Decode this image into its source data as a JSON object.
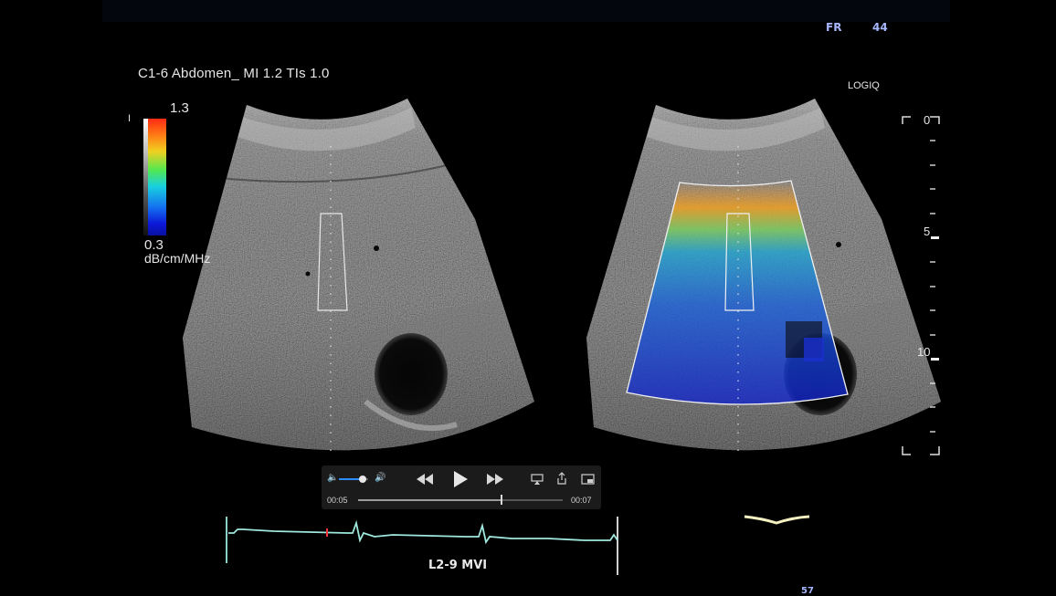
{
  "header": {
    "fr_label": "FR",
    "fr_value": "44"
  },
  "probe_info": "C1-6  Abdomen_  MI 1.2  TIs 1.0",
  "brand": "LOGIQ",
  "color_scale": {
    "max": "1.3",
    "min": "0.3",
    "unit": "dB/cm/MHz",
    "tick": "I"
  },
  "depth_scale": {
    "labels": [
      "0",
      "5",
      "10"
    ]
  },
  "player": {
    "current_time": "00:05",
    "duration": "00:07",
    "volume": 0.8,
    "progress": 0.7
  },
  "mode_label": "L2-9  MVI",
  "bottom_number": "57",
  "colors": {
    "overlay_accent": "#a6b7ff",
    "volume_fill": "#2d8cff",
    "ecg": "#9fe8dd"
  }
}
